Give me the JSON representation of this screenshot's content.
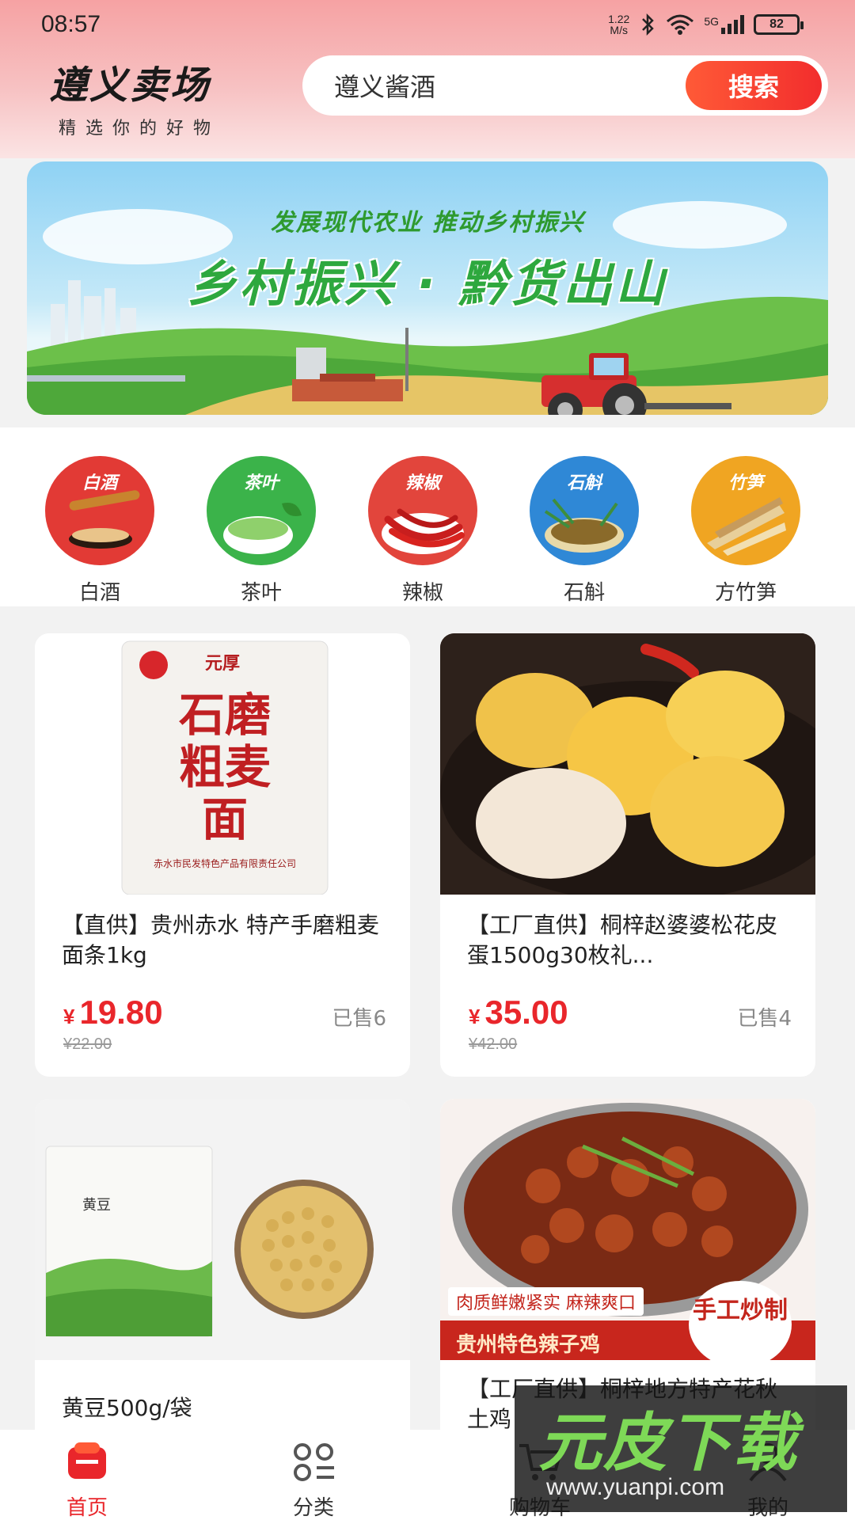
{
  "status_bar": {
    "time": "08:57",
    "speed_top": "1.22",
    "speed_bottom": "M/s",
    "network": "5G",
    "battery": "82"
  },
  "header": {
    "logo_title": "遵义卖场",
    "logo_subtitle": "精选你的好物",
    "search_value": "遵义酱酒",
    "search_button": "搜索"
  },
  "banner": {
    "subtitle": "发展现代农业 推动乡村振兴",
    "title": "乡村振兴 · 黔货出山"
  },
  "categories": [
    {
      "tag": "白酒",
      "label": "白酒",
      "color": "#e23a35"
    },
    {
      "tag": "茶叶",
      "label": "茶叶",
      "color": "#3bb34a"
    },
    {
      "tag": "辣椒",
      "label": "辣椒",
      "color": "#e2453c"
    },
    {
      "tag": "石斛",
      "label": "石斛",
      "color": "#2f88d6"
    },
    {
      "tag": "竹笋",
      "label": "方竹笋",
      "color": "#f0a522"
    }
  ],
  "products": [
    {
      "title": "【直供】贵州赤水 特产手磨粗麦面条1kg",
      "price_symbol": "¥",
      "price": "19.80",
      "sold": "已售6",
      "original_price": "¥22.00",
      "image_text": [
        "元厚",
        "石磨粗麦面",
        "赤水市民发特色产品有限责任公司"
      ]
    },
    {
      "title": "【工厂直供】桐梓赵婆婆松花皮蛋1500g30枚礼...",
      "price_symbol": "¥",
      "price": "35.00",
      "sold": "已售4",
      "original_price": "¥42.00"
    },
    {
      "title": "黄豆500g/袋",
      "image_text": [
        "黄豆"
      ]
    },
    {
      "title": "【工厂直供】桐梓地方特产花秋土鸡",
      "image_text": [
        "肉质鲜嫩紧实 麻辣爽口",
        "手工炒制",
        "贵州特色辣子鸡"
      ]
    }
  ],
  "nav": [
    {
      "label": "首页",
      "icon": "home-icon",
      "active": true
    },
    {
      "label": "分类",
      "icon": "category-icon",
      "active": false
    },
    {
      "label": "购物车",
      "icon": "cart-icon",
      "active": false
    },
    {
      "label": "我的",
      "icon": "user-icon",
      "active": false
    }
  ],
  "watermark": {
    "text": "元皮下载",
    "url": "www.yuanpi.com"
  }
}
